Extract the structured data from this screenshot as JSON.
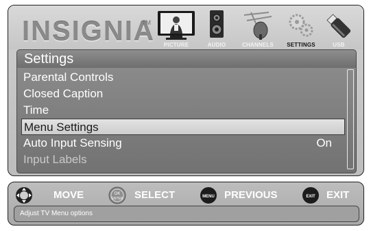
{
  "brand": {
    "logo_text": "INSIGNIA",
    "trademark": "TM"
  },
  "tabs": [
    {
      "label": "PICTURE",
      "icon": "tv-picture-icon",
      "active": false
    },
    {
      "label": "AUDIO",
      "icon": "speaker-icon",
      "active": false
    },
    {
      "label": "CHANNELS",
      "icon": "antenna-satellite-icon",
      "active": false
    },
    {
      "label": "SETTINGS",
      "icon": "gears-icon",
      "active": true
    },
    {
      "label": "USB",
      "icon": "usb-drive-icon",
      "active": false
    }
  ],
  "menu": {
    "title": "Settings",
    "items": [
      {
        "label": "Parental Controls",
        "value": ""
      },
      {
        "label": "Closed Caption",
        "value": ""
      },
      {
        "label": "Time",
        "value": ""
      },
      {
        "label": "Menu Settings",
        "value": "",
        "selected": true
      },
      {
        "label": "Auto Input Sensing",
        "value": "On"
      },
      {
        "label": "Input Labels",
        "value": "",
        "dimmed": true
      }
    ]
  },
  "controls": [
    {
      "label": "MOVE",
      "icon": "dpad-icon"
    },
    {
      "label": "SELECT",
      "icon": "ok-enter-button-icon",
      "icon_text": "OK ENTER"
    },
    {
      "label": "PREVIOUS",
      "icon": "menu-button-icon",
      "icon_text": "MENU"
    },
    {
      "label": "EXIT",
      "icon": "exit-button-icon",
      "icon_text": "EXIT"
    }
  ],
  "help_text": "Adjust TV Menu options"
}
